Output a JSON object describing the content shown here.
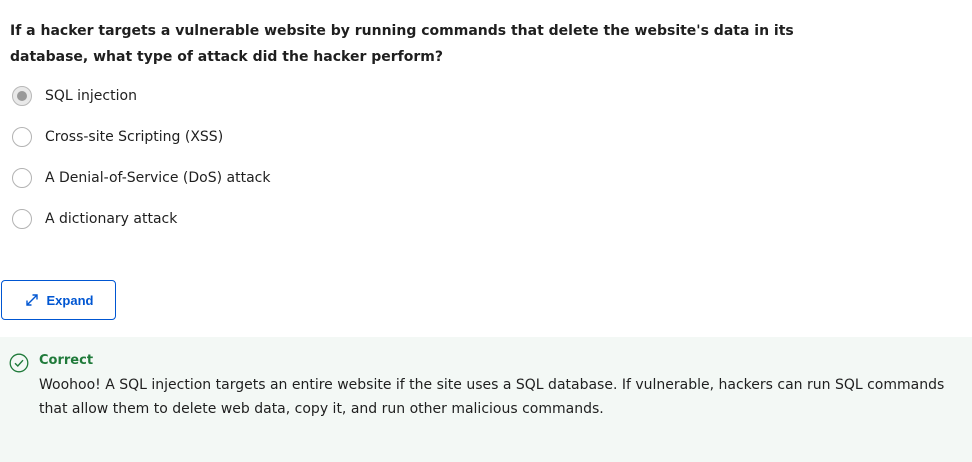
{
  "question": {
    "text": "If a hacker targets a vulnerable website by running commands that delete the website's data in its database, what type of attack did the hacker perform?"
  },
  "options": [
    {
      "label": "SQL injection",
      "selected": true
    },
    {
      "label": "Cross-site Scripting (XSS)",
      "selected": false
    },
    {
      "label": "A Denial-of-Service (DoS) attack",
      "selected": false
    },
    {
      "label": "A dictionary attack",
      "selected": false
    }
  ],
  "expand_button": {
    "label": "Expand",
    "icon": "expand-arrows-icon"
  },
  "feedback": {
    "icon": "check-circle-icon",
    "status": "Correct",
    "message": "Woohoo! A SQL injection targets an entire website if the site uses a SQL database. If vulnerable, hackers can run SQL commands that allow them to delete web data, copy it, and run other malicious commands."
  },
  "colors": {
    "accent": "#0056d2",
    "success": "#1f7a3a",
    "feedback_background": "#f3f8f5"
  }
}
